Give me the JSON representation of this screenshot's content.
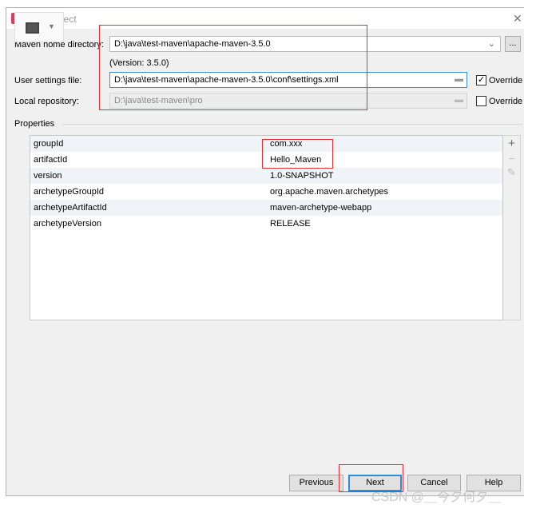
{
  "window": {
    "title": "New Project",
    "close_icon": "close-icon"
  },
  "form": {
    "maven_home": {
      "label": "Maven home directory:",
      "value": "D:\\java\\test-maven\\apache-maven-3.5.0",
      "browse_label": "..."
    },
    "version_text": "(Version: 3.5.0)",
    "user_settings": {
      "label": "User settings file:",
      "value": "D:\\java\\test-maven\\apache-maven-3.5.0\\conf\\settings.xml",
      "override_label": "Override",
      "override_checked": true
    },
    "local_repo": {
      "label": "Local repository:",
      "value": "D:\\java\\test-maven\\pro",
      "override_label": "Override",
      "override_checked": false
    }
  },
  "properties": {
    "label": "Properties",
    "rows": [
      {
        "key": "groupId",
        "value": "com.xxx"
      },
      {
        "key": "artifactId",
        "value": "Hello_Maven"
      },
      {
        "key": "version",
        "value": "1.0-SNAPSHOT"
      },
      {
        "key": "archetypeGroupId",
        "value": "org.apache.maven.archetypes"
      },
      {
        "key": "archetypeArtifactId",
        "value": "maven-archetype-webapp"
      },
      {
        "key": "archetypeVersion",
        "value": "RELEASE"
      }
    ],
    "add_icon": "+",
    "remove_icon": "−",
    "edit_icon": "✎"
  },
  "buttons": {
    "previous": "Previous",
    "next": "Next",
    "cancel": "Cancel",
    "help": "Help"
  },
  "watermark": "CSDN @＿今夕何夕＿",
  "colors": {
    "highlight": "#e53030",
    "focus": "#2a8ee0"
  }
}
